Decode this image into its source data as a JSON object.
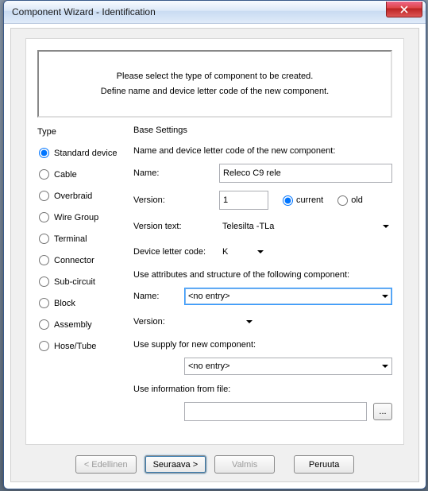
{
  "window": {
    "title": "Component Wizard - Identification"
  },
  "intro": {
    "line1": "Please select the type of component to be created.",
    "line2": "Define name and device letter code of the new component."
  },
  "type": {
    "group_label": "Type",
    "selected": "Standard device",
    "options": [
      "Standard device",
      "Cable",
      "Overbraid",
      "Wire Group",
      "Terminal",
      "Connector",
      "Sub-circuit",
      "Block",
      "Assembly",
      "Hose/Tube"
    ]
  },
  "base": {
    "group_label": "Base Settings",
    "heading": "Name and device letter code of the new component:",
    "name_label": "Name:",
    "name_value": "Releco C9 rele",
    "version_label": "Version:",
    "version_value": "1",
    "version_current_label": "current",
    "version_old_label": "old",
    "version_mode": "current",
    "version_text_label": "Version text:",
    "version_text_value": "Telesilta -TLa",
    "device_code_label": "Device letter code:",
    "device_code_value": "K",
    "attr_heading": "Use attributes and structure of the following component:",
    "attr_name_label": "Name:",
    "attr_name_value": "<no entry>",
    "attr_version_label": "Version:",
    "attr_version_value": "",
    "supply_label": "Use supply for new component:",
    "supply_value": "<no entry>",
    "file_label": "Use information from file:",
    "file_value": "",
    "browse_label": "..."
  },
  "buttons": {
    "back": "< Edellinen",
    "next": "Seuraava >",
    "finish": "Valmis",
    "cancel": "Peruuta"
  }
}
